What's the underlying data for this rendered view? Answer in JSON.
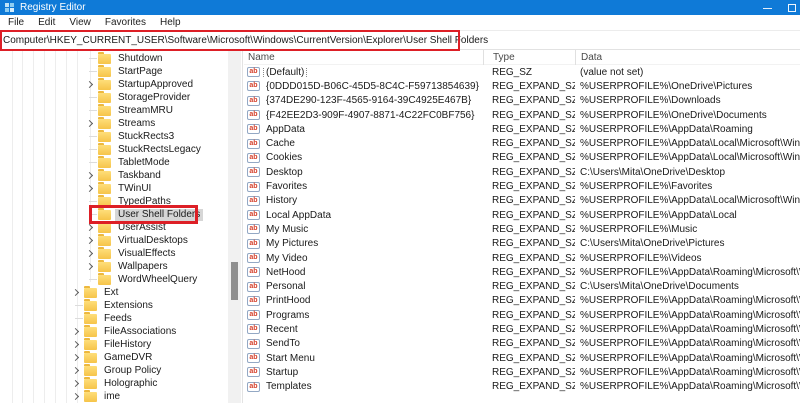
{
  "window": {
    "title": "Registry Editor",
    "controls": {
      "minimize": "minimize",
      "maximize": "maximize"
    }
  },
  "menu_bar": {
    "items": [
      "File",
      "Edit",
      "View",
      "Favorites",
      "Help"
    ]
  },
  "address_bar": {
    "value": "Computer\\HKEY_CURRENT_USER\\Software\\Microsoft\\Windows\\CurrentVersion\\Explorer\\User Shell Folders"
  },
  "annotations": {
    "color": "#dd1f26",
    "boxes": [
      "address-path",
      "selected-tree-item"
    ]
  },
  "icons": {
    "string_value_glyph": "ab"
  },
  "tree": {
    "items": [
      {
        "label": "Shutdown",
        "level": 8,
        "expandable": false,
        "selected": false
      },
      {
        "label": "StartPage",
        "level": 8,
        "expandable": false,
        "selected": false
      },
      {
        "label": "StartupApproved",
        "level": 8,
        "expandable": true,
        "selected": false
      },
      {
        "label": "StorageProvider",
        "level": 8,
        "expandable": false,
        "selected": false
      },
      {
        "label": "StreamMRU",
        "level": 8,
        "expandable": false,
        "selected": false
      },
      {
        "label": "Streams",
        "level": 8,
        "expandable": true,
        "selected": false
      },
      {
        "label": "StuckRects3",
        "level": 8,
        "expandable": false,
        "selected": false
      },
      {
        "label": "StuckRectsLegacy",
        "level": 8,
        "expandable": false,
        "selected": false
      },
      {
        "label": "TabletMode",
        "level": 8,
        "expandable": false,
        "selected": false
      },
      {
        "label": "Taskband",
        "level": 8,
        "expandable": true,
        "selected": false
      },
      {
        "label": "TWinUI",
        "level": 8,
        "expandable": true,
        "selected": false
      },
      {
        "label": "TypedPaths",
        "level": 8,
        "expandable": false,
        "selected": false
      },
      {
        "label": "User Shell Folders",
        "level": 8,
        "expandable": false,
        "selected": true
      },
      {
        "label": "UserAssist",
        "level": 8,
        "expandable": true,
        "selected": false
      },
      {
        "label": "VirtualDesktops",
        "level": 8,
        "expandable": true,
        "selected": false
      },
      {
        "label": "VisualEffects",
        "level": 8,
        "expandable": true,
        "selected": false
      },
      {
        "label": "Wallpapers",
        "level": 8,
        "expandable": true,
        "selected": false
      },
      {
        "label": "WordWheelQuery",
        "level": 8,
        "expandable": false,
        "selected": false
      },
      {
        "label": "Ext",
        "level": 7,
        "expandable": true,
        "selected": false
      },
      {
        "label": "Extensions",
        "level": 7,
        "expandable": false,
        "selected": false
      },
      {
        "label": "Feeds",
        "level": 7,
        "expandable": false,
        "selected": false
      },
      {
        "label": "FileAssociations",
        "level": 7,
        "expandable": true,
        "selected": false
      },
      {
        "label": "FileHistory",
        "level": 7,
        "expandable": true,
        "selected": false
      },
      {
        "label": "GameDVR",
        "level": 7,
        "expandable": true,
        "selected": false
      },
      {
        "label": "Group Policy",
        "level": 7,
        "expandable": true,
        "selected": false
      },
      {
        "label": "Holographic",
        "level": 7,
        "expandable": true,
        "selected": false
      },
      {
        "label": "ime",
        "level": 7,
        "expandable": true,
        "selected": false
      }
    ]
  },
  "list": {
    "columns": [
      "Name",
      "Type",
      "Data"
    ],
    "rows": [
      {
        "name": "(Default)",
        "type": "REG_SZ",
        "data": "(value not set)",
        "focused": true
      },
      {
        "name": "{0DDD015D-B06C-45D5-8C4C-F59713854639}",
        "type": "REG_EXPAND_SZ",
        "data": "%USERPROFILE%\\OneDrive\\Pictures",
        "focused": false
      },
      {
        "name": "{374DE290-123F-4565-9164-39C4925E467B}",
        "type": "REG_EXPAND_SZ",
        "data": "%USERPROFILE%\\Downloads",
        "focused": false
      },
      {
        "name": "{F42EE2D3-909F-4907-8871-4C22FC0BF756}",
        "type": "REG_EXPAND_SZ",
        "data": "%USERPROFILE%\\OneDrive\\Documents",
        "focused": false
      },
      {
        "name": "AppData",
        "type": "REG_EXPAND_SZ",
        "data": "%USERPROFILE%\\AppData\\Roaming",
        "focused": false
      },
      {
        "name": "Cache",
        "type": "REG_EXPAND_SZ",
        "data": "%USERPROFILE%\\AppData\\Local\\Microsoft\\Windo...",
        "focused": false
      },
      {
        "name": "Cookies",
        "type": "REG_EXPAND_SZ",
        "data": "%USERPROFILE%\\AppData\\Local\\Microsoft\\Windo...",
        "focused": false
      },
      {
        "name": "Desktop",
        "type": "REG_EXPAND_SZ",
        "data": "C:\\Users\\Mita\\OneDrive\\Desktop",
        "focused": false
      },
      {
        "name": "Favorites",
        "type": "REG_EXPAND_SZ",
        "data": "%USERPROFILE%\\Favorites",
        "focused": false
      },
      {
        "name": "History",
        "type": "REG_EXPAND_SZ",
        "data": "%USERPROFILE%\\AppData\\Local\\Microsoft\\Windo...",
        "focused": false
      },
      {
        "name": "Local AppData",
        "type": "REG_EXPAND_SZ",
        "data": "%USERPROFILE%\\AppData\\Local",
        "focused": false
      },
      {
        "name": "My Music",
        "type": "REG_EXPAND_SZ",
        "data": "%USERPROFILE%\\Music",
        "focused": false
      },
      {
        "name": "My Pictures",
        "type": "REG_EXPAND_SZ",
        "data": "C:\\Users\\Mita\\OneDrive\\Pictures",
        "focused": false
      },
      {
        "name": "My Video",
        "type": "REG_EXPAND_SZ",
        "data": "%USERPROFILE%\\Videos",
        "focused": false
      },
      {
        "name": "NetHood",
        "type": "REG_EXPAND_SZ",
        "data": "%USERPROFILE%\\AppData\\Roaming\\Microsoft\\Wi...",
        "focused": false
      },
      {
        "name": "Personal",
        "type": "REG_EXPAND_SZ",
        "data": "C:\\Users\\Mita\\OneDrive\\Documents",
        "focused": false
      },
      {
        "name": "PrintHood",
        "type": "REG_EXPAND_SZ",
        "data": "%USERPROFILE%\\AppData\\Roaming\\Microsoft\\Wi...",
        "focused": false
      },
      {
        "name": "Programs",
        "type": "REG_EXPAND_SZ",
        "data": "%USERPROFILE%\\AppData\\Roaming\\Microsoft\\Wi...",
        "focused": false
      },
      {
        "name": "Recent",
        "type": "REG_EXPAND_SZ",
        "data": "%USERPROFILE%\\AppData\\Roaming\\Microsoft\\Wi...",
        "focused": false
      },
      {
        "name": "SendTo",
        "type": "REG_EXPAND_SZ",
        "data": "%USERPROFILE%\\AppData\\Roaming\\Microsoft\\Wi...",
        "focused": false
      },
      {
        "name": "Start Menu",
        "type": "REG_EXPAND_SZ",
        "data": "%USERPROFILE%\\AppData\\Roaming\\Microsoft\\Wi...",
        "focused": false
      },
      {
        "name": "Startup",
        "type": "REG_EXPAND_SZ",
        "data": "%USERPROFILE%\\AppData\\Roaming\\Microsoft\\Wi...",
        "focused": false
      },
      {
        "name": "Templates",
        "type": "REG_EXPAND_SZ",
        "data": "%USERPROFILE%\\AppData\\Roaming\\Microsoft\\Wi...",
        "focused": false
      }
    ]
  }
}
